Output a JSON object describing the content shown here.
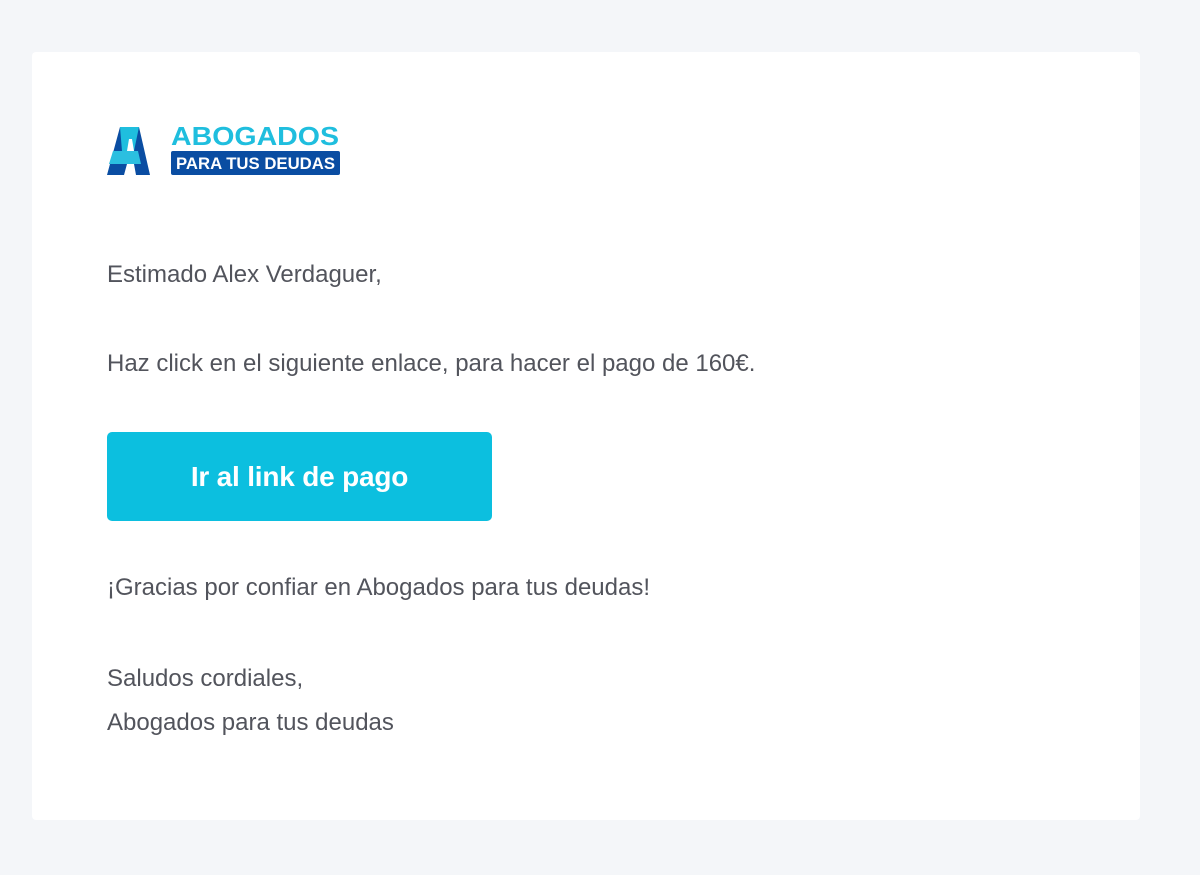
{
  "brand": {
    "line1": "ABOGADOS",
    "line2": "PARA TUS DEUDAS",
    "colors": {
      "cyan": "#1fbede",
      "navy": "#0a4da2"
    }
  },
  "email": {
    "greeting": "Estimado Alex Verdaguer,",
    "instruction": "Haz click en el siguiente enlace, para hacer el pago de 160€.",
    "button_label": "Ir al link de pago",
    "thanks": "¡Gracias por confiar en Abogados para tus deudas!",
    "closing": "Saludos cordiales,",
    "signature": "Abogados para tus deudas"
  },
  "theme": {
    "page_background": "#f4f6f9",
    "card_background": "#ffffff",
    "button_color": "#0cbfdf",
    "text_color": "#52545c"
  }
}
